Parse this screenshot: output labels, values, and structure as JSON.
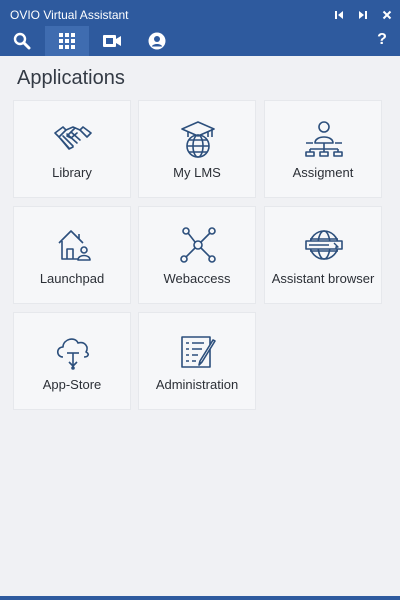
{
  "window": {
    "title": "OVIO Virtual Assistant"
  },
  "window_controls": [
    {
      "name": "prev-icon"
    },
    {
      "name": "next-icon"
    },
    {
      "name": "close-icon"
    }
  ],
  "toolbar": {
    "items": [
      {
        "name": "search-icon",
        "active": false
      },
      {
        "name": "apps-grid-icon",
        "active": true
      },
      {
        "name": "video-camera-icon",
        "active": false
      },
      {
        "name": "user-account-icon",
        "active": false
      }
    ],
    "help_label": "?"
  },
  "section": {
    "title": "Applications"
  },
  "apps": [
    {
      "label": "Library",
      "icon": "handshake-icon"
    },
    {
      "label": "My LMS",
      "icon": "graduation-globe-icon"
    },
    {
      "label": "Assigment",
      "icon": "user-network-icon"
    },
    {
      "label": "Launchpad",
      "icon": "home-user-icon"
    },
    {
      "label": "Webaccess",
      "icon": "network-nodes-icon"
    },
    {
      "label": "Assistant browser",
      "icon": "globe-browser-icon"
    },
    {
      "label": "App-Store",
      "icon": "cloud-download-icon"
    },
    {
      "label": "Administration",
      "icon": "settings-list-icon"
    }
  ],
  "colors": {
    "titlebar": "#2e5a9e",
    "active_tab": "#3f6cb0",
    "background": "#f0f1f4",
    "tile": "#f6f7f9",
    "icon_stroke": "#2c4f7c"
  }
}
